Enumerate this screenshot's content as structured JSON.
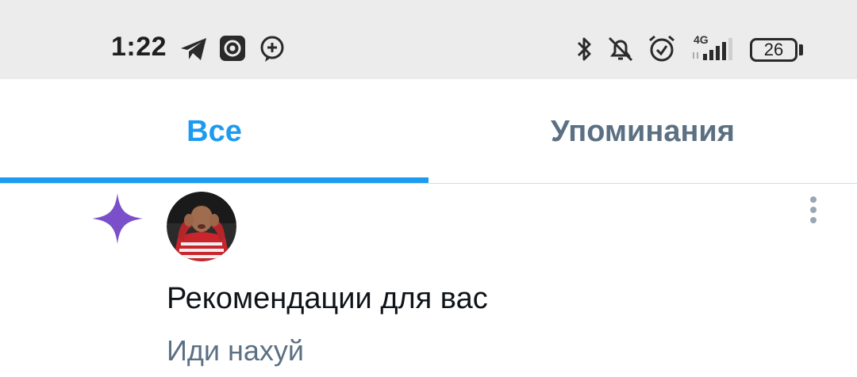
{
  "status_bar": {
    "time": "1:22",
    "network": "4G",
    "battery": "26",
    "icons": [
      "telegram-icon",
      "app-icon",
      "chat-add-icon",
      "bluetooth-icon",
      "bell-off-icon",
      "alarm-icon",
      "signal-icon",
      "battery-icon"
    ]
  },
  "tabs": [
    {
      "label": "Все",
      "active": true
    },
    {
      "label": "Упоминания",
      "active": false
    }
  ],
  "notification": {
    "icon": "sparkle-icon",
    "title": "Рекомендации для вас",
    "subtitle": "Иди нахуй"
  },
  "colors": {
    "accent": "#1d9bf0",
    "sparkle": "#7b4fc9",
    "secondary_text": "#5b7083",
    "status_bar_bg": "#ececec"
  }
}
